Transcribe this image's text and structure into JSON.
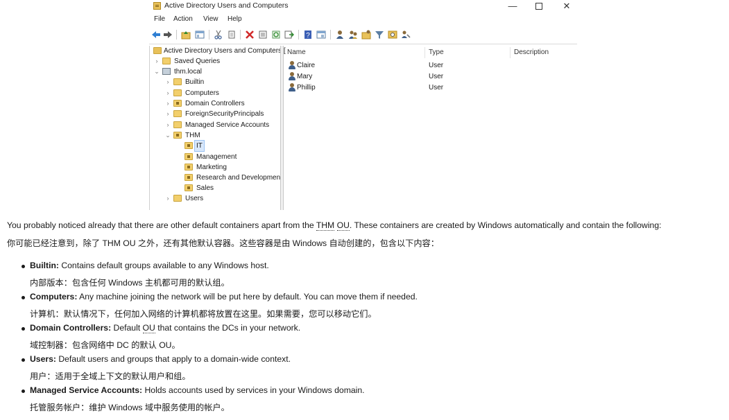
{
  "window": {
    "title": "Active Directory Users and Computers",
    "controls": {
      "minimize": "—",
      "maximize": "",
      "close": "✕"
    },
    "menu": [
      "File",
      "Action",
      "View",
      "Help"
    ]
  },
  "toolbar_icons": [
    "back-arrow-icon",
    "forward-arrow-icon",
    "up-folder-icon",
    "show-hide-console-tree-icon",
    "cut-icon",
    "copy-icon",
    "delete-icon",
    "properties-icon",
    "refresh-icon",
    "export-list-icon",
    "help-icon",
    "console-view-icon",
    "new-user-icon",
    "new-group-icon",
    "new-ou-icon",
    "filter-icon",
    "find-icon",
    "add-to-group-icon"
  ],
  "tree": {
    "root": "Active Directory Users and Computers [",
    "saved_queries": "Saved Queries",
    "domain": "thm.local",
    "builtin": "Builtin",
    "computers": "Computers",
    "domain_controllers": "Domain Controllers",
    "foreign_security_principals": "ForeignSecurityPrincipals",
    "managed_service_accounts": "Managed Service Accounts",
    "thm": "THM",
    "it": "IT",
    "management": "Management",
    "marketing": "Marketing",
    "research": "Research and Development",
    "sales": "Sales",
    "users": "Users"
  },
  "list": {
    "columns": {
      "name": "Name",
      "type": "Type",
      "description": "Description"
    },
    "rows": [
      {
        "name": "Claire",
        "type": "User"
      },
      {
        "name": "Mary",
        "type": "User"
      },
      {
        "name": "Phillip",
        "type": "User"
      }
    ]
  },
  "article": {
    "intro_en_1": "You probably noticed already that there are other default containers apart from the ",
    "intro_en_thm": "THM",
    "intro_en_ou": "OU",
    "intro_en_2": ". These containers are created by Windows automatically and contain the following:",
    "intro_zh": "你可能已经注意到，除了 THM OU 之外，还有其他默认容器。这些容器是由 Windows 自动创建的，包含以下内容：",
    "items": [
      {
        "term": "Builtin:",
        "text": " Contains default groups available to any Windows host.",
        "zh": "内部版本：包含任何 Windows 主机都可用的默认组。"
      },
      {
        "term": "Computers:",
        "text": " Any machine joining the network will be put here by default. You can move them if needed.",
        "zh": "计算机：默认情况下，任何加入网络的计算机都将放置在这里。如果需要，您可以移动它们。"
      },
      {
        "term": "Domain Controllers:",
        "text_1": " Default ",
        "ou": "OU",
        "text_2": " that contains the DCs in your network.",
        "zh": "域控制器：包含网络中 DC 的默认 OU。"
      },
      {
        "term": "Users:",
        "text": " Default users and groups that apply to a domain-wide context.",
        "zh": "用户：适用于全域上下文的默认用户和组。"
      },
      {
        "term": "Managed Service Accounts:",
        "text": " Holds accounts used by services in your Windows domain.",
        "zh": "托管服务帐户：维护 Windows 域中服务使用的帐户。"
      }
    ]
  }
}
